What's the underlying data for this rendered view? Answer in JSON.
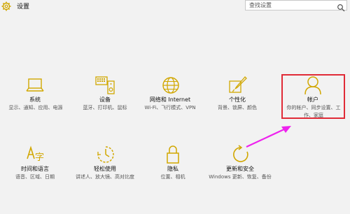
{
  "titlebar": {
    "title": "设置"
  },
  "search": {
    "placeholder": "查找设置"
  },
  "tiles": [
    {
      "label": "系统",
      "desc": "显示、通知、应用、电源",
      "icon": "laptop-icon"
    },
    {
      "label": "设备",
      "desc": "蓝牙、打印机、鼠标",
      "icon": "devices-icon"
    },
    {
      "label": "网络和 Internet",
      "desc": "Wi-Fi、飞行模式、VPN",
      "icon": "globe-icon"
    },
    {
      "label": "个性化",
      "desc": "背景、锁屏、颜色",
      "icon": "paintbrush-icon"
    },
    {
      "label": "帐户",
      "desc": "你的帐户、同步设置、工作、家庭",
      "icon": "person-icon"
    },
    {
      "label": "时间和语言",
      "desc": "语音、区域、日期",
      "icon": "time-language-icon"
    },
    {
      "label": "轻松使用",
      "desc": "讲述人、放大镜、高对比度",
      "icon": "ease-of-access-icon"
    },
    {
      "label": "隐私",
      "desc": "位置、相机",
      "icon": "lock-icon"
    },
    {
      "label": "更新和安全",
      "desc": "Windows 更新、恢复、备份",
      "icon": "update-icon"
    }
  ],
  "colors": {
    "accent": "#d1a700",
    "highlight": "#e02b37",
    "arrow": "#ee22ee"
  }
}
